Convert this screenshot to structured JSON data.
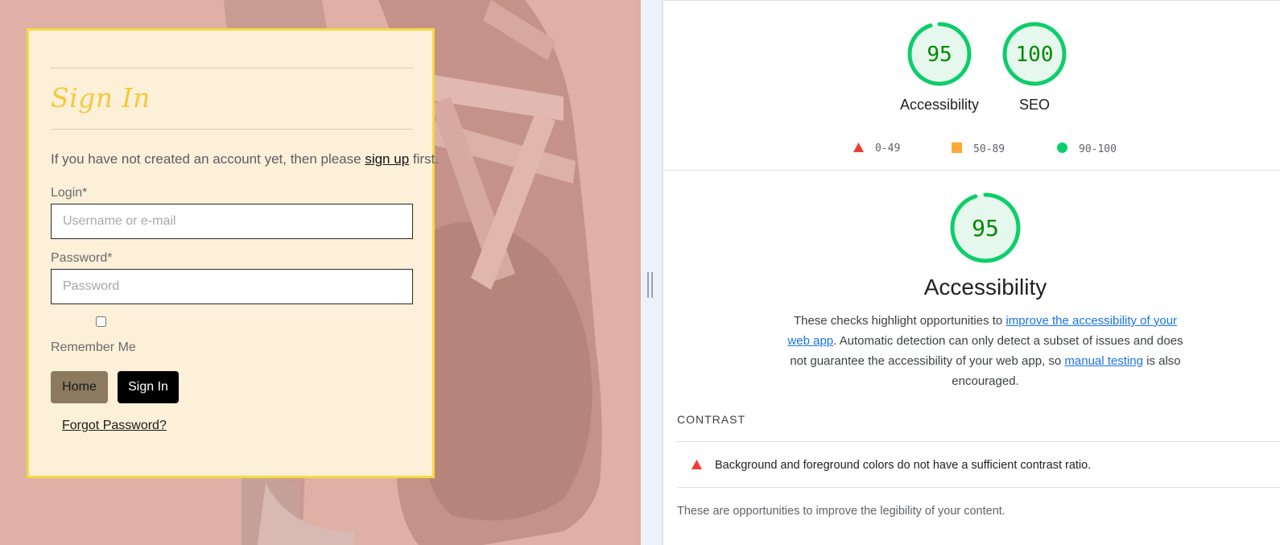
{
  "login": {
    "title": "Sign In",
    "intro_before": "If you have not created an account yet, then please ",
    "signup_link": "sign up",
    "intro_after": " first.",
    "login_label": "Login*",
    "login_placeholder": "Username or e-mail",
    "password_label": "Password*",
    "password_placeholder": "Password",
    "remember_label": "Remember Me",
    "remember_checked": false,
    "home_button": "Home",
    "signin_button": "Sign In",
    "forgot_link": "Forgot Password?"
  },
  "report": {
    "scores": [
      {
        "value": "95",
        "label": "Accessibility",
        "score": 95
      },
      {
        "value": "100",
        "label": "SEO",
        "score": 100
      }
    ],
    "legend": [
      {
        "shape": "triangle",
        "color": "#f33b33",
        "range": "0-49"
      },
      {
        "shape": "square",
        "color": "#ffa833",
        "range": "50-89"
      },
      {
        "shape": "circle",
        "color": "#0cce6b",
        "range": "90-100"
      }
    ],
    "category": {
      "score_text": "95",
      "score": 95,
      "title": "Accessibility",
      "desc_1": "These checks highlight opportunities to ",
      "link_1": "improve the accessibility of your web app",
      "desc_2": ". Automatic detection can only detect a subset of issues and does not guarantee the accessibility of your web app, so ",
      "link_2": "manual testing",
      "desc_3": " is also encouraged."
    },
    "section_title": "CONTRAST",
    "audit_text": "Background and foreground colors do not have a sufficient contrast ratio.",
    "footer_text": "These are opportunities to improve the legibility of your content.",
    "colors": {
      "pass": "#0cce6b",
      "pass_fill": "#e6f8ee",
      "pass_text": "#008800",
      "fail": "#f33b33",
      "average": "#ffa833",
      "card_border": "#f6d93f",
      "title": "#f3c93d"
    }
  }
}
